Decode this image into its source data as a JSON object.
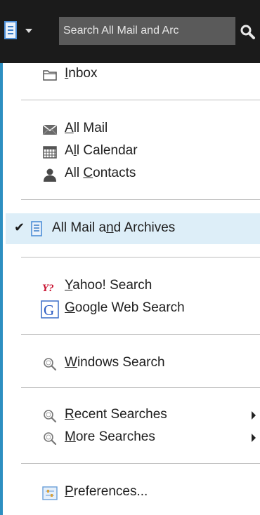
{
  "toolbar": {
    "search_placeholder": "Search All Mail and Arc",
    "scope_icon": "archive-icon",
    "dropdown_icon": "chevron-down-icon",
    "search_icon": "magnifier-icon"
  },
  "menu": {
    "inbox": {
      "pre": "",
      "key": "I",
      "post": "nbox"
    },
    "all_mail": {
      "pre": "",
      "key": "A",
      "post": "ll Mail"
    },
    "all_calendar": {
      "pre": "A",
      "key": "l",
      "post": "l Calendar"
    },
    "all_contacts": {
      "pre": "All ",
      "key": "C",
      "post": "ontacts"
    },
    "all_mail_archives": {
      "pre": "All Mail a",
      "key": "n",
      "post": "d Archives",
      "checked": "✔"
    },
    "yahoo": {
      "pre": "",
      "key": "Y",
      "post": "ahoo! Search"
    },
    "google": {
      "pre": "",
      "key": "G",
      "post": "oogle Web Search"
    },
    "windows": {
      "pre": "",
      "key": "W",
      "post": "indows Search"
    },
    "recent": {
      "pre": "",
      "key": "R",
      "post": "ecent Searches"
    },
    "more": {
      "pre": "",
      "key": "M",
      "post": "ore Searches"
    },
    "preferences": {
      "pre": "",
      "key": "P",
      "post": "references..."
    }
  },
  "colors": {
    "topbar_bg": "#1b1b1b",
    "accent_border": "#2d8fc1",
    "selected_bg": "#ddeef8"
  }
}
